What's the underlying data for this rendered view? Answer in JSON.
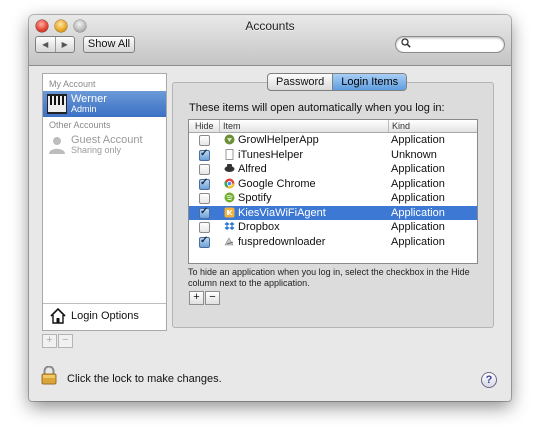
{
  "window": {
    "title": "Accounts"
  },
  "toolbar": {
    "back": "◀",
    "forward": "▶",
    "show_all_label": "Show All",
    "search_placeholder": ""
  },
  "sidebar": {
    "my_account_heading": "My Account",
    "other_accounts_heading": "Other Accounts",
    "users": [
      {
        "name": "Werner",
        "role": "Admin",
        "selected": true
      },
      {
        "name": "Guest Account",
        "role": "Sharing only",
        "selected": false
      }
    ],
    "login_options_label": "Login Options",
    "add_label": "+",
    "remove_label": "−"
  },
  "tabs": [
    {
      "label": "Password",
      "selected": false
    },
    {
      "label": "Login Items",
      "selected": true
    }
  ],
  "login_items": {
    "intro": "These items will open automatically when you log in:",
    "columns": {
      "hide": "Hide",
      "item": "Item",
      "kind": "Kind"
    },
    "rows": [
      {
        "hide": false,
        "item": "GrowlHelperApp",
        "kind": "Application",
        "icon": "growl-icon",
        "selected": false
      },
      {
        "hide": true,
        "item": "iTunesHelper",
        "kind": "Unknown",
        "icon": "document-icon",
        "selected": false
      },
      {
        "hide": false,
        "item": "Alfred",
        "kind": "Application",
        "icon": "alfred-icon",
        "selected": false
      },
      {
        "hide": true,
        "item": "Google Chrome",
        "kind": "Application",
        "icon": "chrome-icon",
        "selected": false
      },
      {
        "hide": false,
        "item": "Spotify",
        "kind": "Application",
        "icon": "spotify-icon",
        "selected": false
      },
      {
        "hide": true,
        "item": "KiesViaWiFiAgent",
        "kind": "Application",
        "icon": "kies-icon",
        "selected": true
      },
      {
        "hide": false,
        "item": "Dropbox",
        "kind": "Application",
        "icon": "dropbox-icon",
        "selected": false
      },
      {
        "hide": true,
        "item": "fuspredownloader",
        "kind": "Application",
        "icon": "app-icon",
        "selected": false
      }
    ],
    "hint": "To hide an application when you log in, select the checkbox in the Hide column next to the application.",
    "add_label": "+",
    "remove_label": "−"
  },
  "footer": {
    "lock_text": "Click the lock to make changes.",
    "help_label": "?"
  },
  "colors": {
    "selection": "#3c78d4",
    "tab_selected": "#5e9de0"
  }
}
